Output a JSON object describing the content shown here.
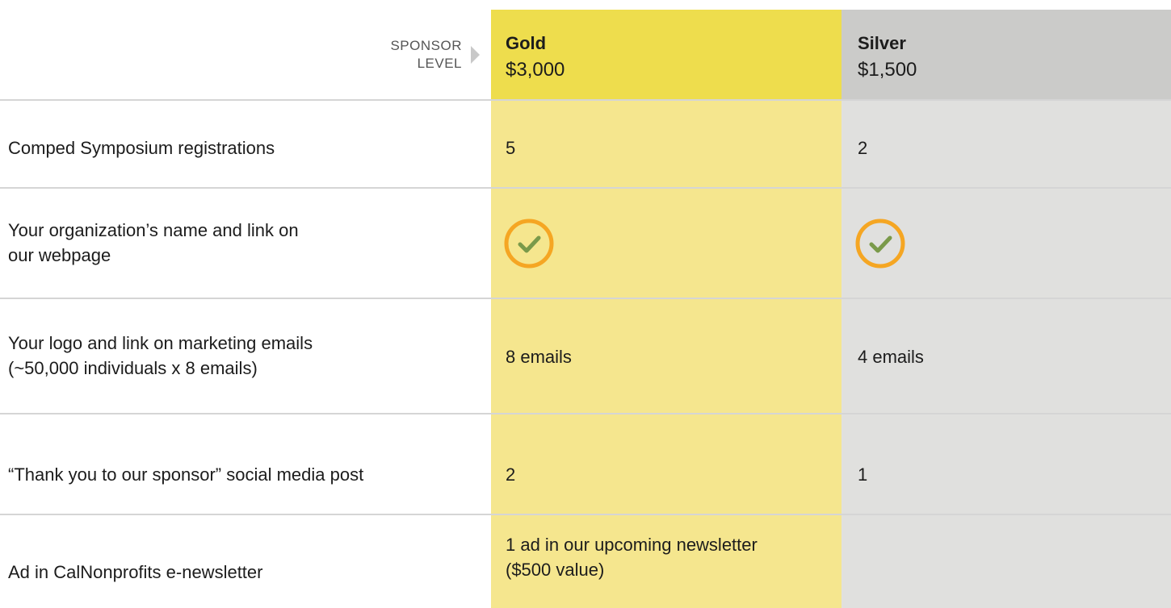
{
  "header": {
    "sponsor_label_line1": "SPONSOR",
    "sponsor_label_line2": "LEVEL",
    "tiers": [
      {
        "name": "Gold",
        "price": "$3,000"
      },
      {
        "name": "Silver",
        "price": "$1,500"
      }
    ]
  },
  "colors": {
    "gold_header": "#eedd4d",
    "gold_body": "#f5e68e",
    "silver_header": "#cbcbc9",
    "silver_body": "#e0e0de",
    "check_ring": "#f5a623",
    "check_mark": "#7a9a4a"
  },
  "rows": [
    {
      "feature": "Comped Symposium registrations",
      "gold": "5",
      "silver": "2"
    },
    {
      "feature_line1": "Your organization’s name and link on",
      "feature_line2": "our webpage",
      "gold_icon": "check-circle-icon",
      "silver_icon": "check-circle-icon"
    },
    {
      "feature_line1": "Your logo and link on marketing emails",
      "feature_line2": "(~50,000 individuals x 8 emails)",
      "gold": "8 emails",
      "silver": "4 emails"
    },
    {
      "feature": "“Thank you to our sponsor” social media post",
      "gold": "2",
      "silver": "1"
    },
    {
      "feature": "Ad in CalNonprofits e-newsletter",
      "gold_line1": "1 ad in our upcoming newsletter",
      "gold_line2": "($500 value)",
      "silver": ""
    }
  ]
}
